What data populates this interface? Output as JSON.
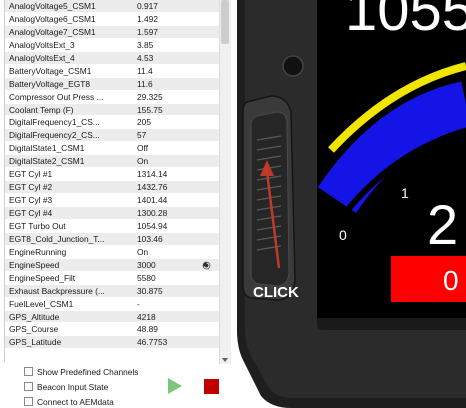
{
  "channels": [
    {
      "name": "AnalogVoltage5_CSM1",
      "value": "0.917"
    },
    {
      "name": "AnalogVoltage6_CSM1",
      "value": "1.492"
    },
    {
      "name": "AnalogVoltage7_CSM1",
      "value": "1.597"
    },
    {
      "name": "AnalogVoltsExt_3",
      "value": "3.85"
    },
    {
      "name": "AnalogVoltsExt_4",
      "value": "4.53"
    },
    {
      "name": "BatteryVoltage_CSM1",
      "value": "11.4"
    },
    {
      "name": "BatteryVoltage_EGT8",
      "value": "11.6"
    },
    {
      "name": "Compressor Out Press ...",
      "value": "29.325"
    },
    {
      "name": "Coolant Temp (F)",
      "value": "155.75"
    },
    {
      "name": "DigitalFrequency1_CS...",
      "value": "205"
    },
    {
      "name": "DigitalFrequency2_CS...",
      "value": "57"
    },
    {
      "name": "DigitalState1_CSM1",
      "value": "Off"
    },
    {
      "name": "DigitalState2_CSM1",
      "value": "On"
    },
    {
      "name": "EGT Cyl #1",
      "value": "1314.14"
    },
    {
      "name": "EGT Cyl #2",
      "value": "1432.76"
    },
    {
      "name": "EGT Cyl #3",
      "value": "1401.44"
    },
    {
      "name": "EGT Cyl #4",
      "value": "1300.28"
    },
    {
      "name": "EGT Turbo Out",
      "value": "1054.94"
    },
    {
      "name": "EGT8_Cold_Junction_T...",
      "value": "103.46"
    },
    {
      "name": "EngineRunning",
      "value": "On"
    },
    {
      "name": "EngineSpeed",
      "value": "3000"
    },
    {
      "name": "EngineSpeed_Filt",
      "value": "5580"
    },
    {
      "name": "Exhaust Backpressure (...",
      "value": "30.875"
    },
    {
      "name": "FuelLevel_CSM1",
      "value": "-"
    },
    {
      "name": "GPS_Altitude",
      "value": "4218"
    },
    {
      "name": "GPS_Course",
      "value": "48.89"
    },
    {
      "name": "GPS_Latitude",
      "value": "46.7753"
    }
  ],
  "options": {
    "show_predefined": "Show Predefined Channels",
    "beacon_input": "Beacon Input State",
    "connect_aemdata": "Connect to AEMdata"
  },
  "device": {
    "top_value": "1055",
    "scale_label_1": "1",
    "scale_label_0": "0",
    "gear_value": "2",
    "red_box_value": "0",
    "annotation": "CLICK"
  },
  "colors": {
    "row_alt": "#ececec",
    "play": "#7cc67c",
    "stop": "#c00000",
    "arc_yellow": "#f2e600",
    "arc_blue": "#1414e6",
    "red_box": "#ff0000",
    "arrow": "#c0392b"
  },
  "icons": {
    "engine_speed_row_icon": "spiral-icon"
  }
}
